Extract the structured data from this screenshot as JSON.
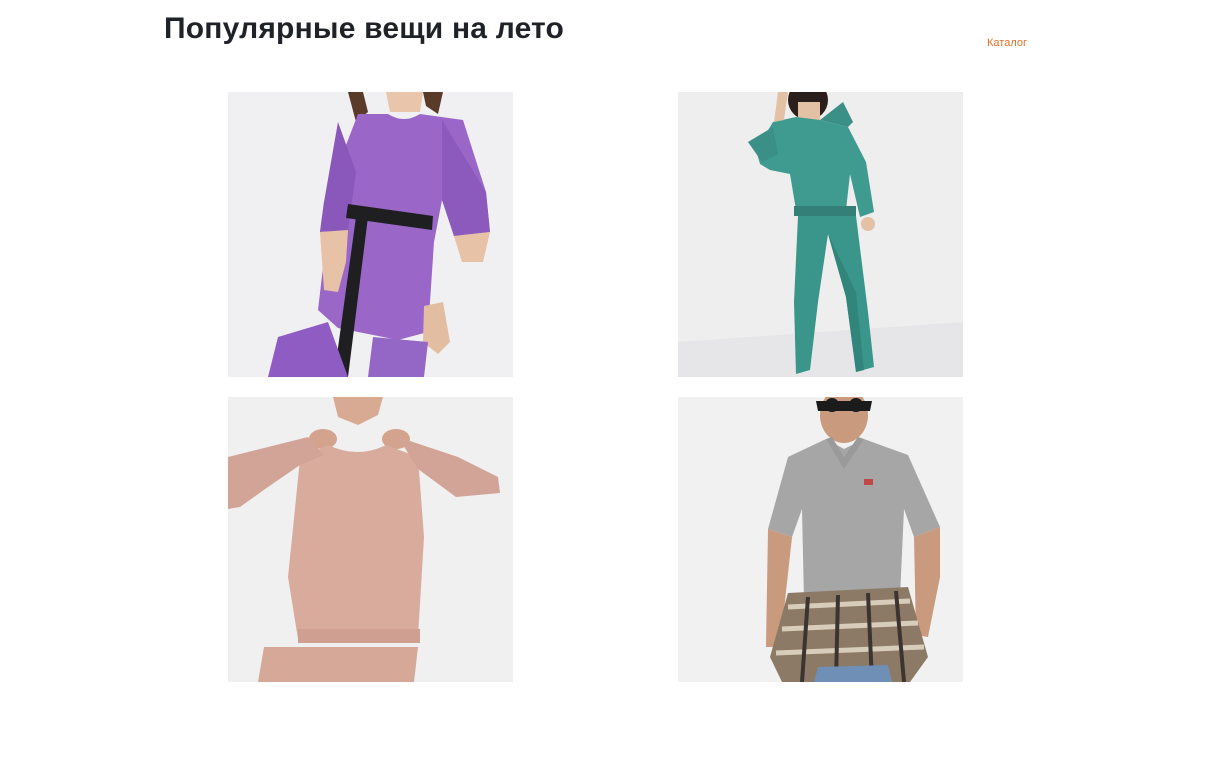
{
  "header": {
    "title": "Популярные вещи на лето",
    "catalog_link": "Каталог",
    "link_color": "#e4702a"
  },
  "products": [
    {
      "color_name": "lilac",
      "color": "#9a66c8"
    },
    {
      "color_name": "teal",
      "color": "#3f9a90"
    },
    {
      "color_name": "beige-pink",
      "color": "#d8ab9d"
    },
    {
      "color_name": "grey",
      "color": "#a6a6a6"
    }
  ]
}
